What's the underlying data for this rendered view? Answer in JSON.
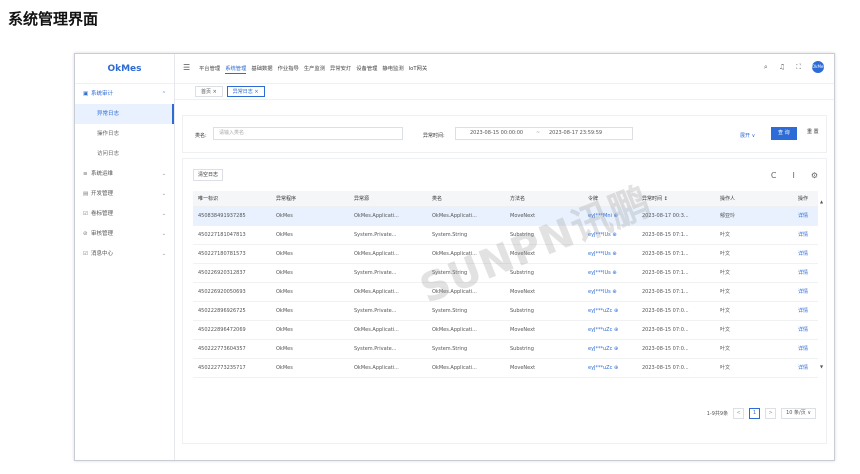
{
  "page_heading": "系统管理界面",
  "sidebar": {
    "logo": "OkMes",
    "groups": [
      {
        "icon": "▣",
        "label": "系统审计",
        "chevron": "⌃",
        "open": true,
        "children": [
          "异常日志",
          "操作日志",
          "访问日志"
        ]
      },
      {
        "icon": "≡",
        "label": "系统运维",
        "chevron": "⌄"
      },
      {
        "icon": "▤",
        "label": "开发管理",
        "chevron": "⌄"
      },
      {
        "icon": "☑",
        "label": "卷标管理",
        "chevron": "⌄"
      },
      {
        "icon": "⊘",
        "label": "审核管理",
        "chevron": "⌄"
      },
      {
        "icon": "☑",
        "label": "消息中心",
        "chevron": "⌄"
      }
    ]
  },
  "topbar": {
    "hamburger": "☰",
    "nav": [
      "平台管理",
      "系统管理",
      "基础数据",
      "作业指导",
      "生产监测",
      "异常安灯",
      "设备管理",
      "静电监测",
      "IoT网关"
    ],
    "icons": [
      "⌕",
      "♫",
      "⛶"
    ],
    "avatar_text": "OkMes"
  },
  "tabs": [
    "首页 ×",
    "异常日志 ×"
  ],
  "search": {
    "class_label": "类名:",
    "class_placeholder": "请输入类名",
    "time_label": "异常时间:",
    "date_start": "2023-08-15 00:00:00",
    "date_sep": "~",
    "date_end": "2023-08-17 23:59:59",
    "expand": "展开 ∨",
    "query": "查 询",
    "reset": "重 置"
  },
  "table": {
    "clear_button": "清空日志",
    "tool_icons": [
      "C",
      "I",
      "⚙"
    ],
    "columns": [
      "唯一标识",
      "异常程序",
      "异常源",
      "类名",
      "方法名",
      "令牌",
      "异常时间 ↕",
      "操作人",
      "操作"
    ],
    "rows": [
      [
        "450838491937285",
        "OkMes",
        "OkMes.Applicati...",
        "OkMes.Applicati...",
        "MoveNext",
        "eyJ***Mni ⊕",
        "2023-08-17 00:3...",
        "郁亚玲",
        "详情"
      ],
      [
        "450227181047813",
        "OkMes",
        "System.Private...",
        "System.String",
        "Substring",
        "eyJ***IUs ⊕",
        "2023-08-15 07:1...",
        "叶文",
        "详情"
      ],
      [
        "450227180781573",
        "OkMes",
        "OkMes.Applicati...",
        "OkMes.Applicati...",
        "MoveNext",
        "eyJ***IUs ⊕",
        "2023-08-15 07:1...",
        "叶文",
        "详情"
      ],
      [
        "450226920312837",
        "OkMes",
        "System.Private...",
        "System.String",
        "Substring",
        "eyJ***IUs ⊕",
        "2023-08-15 07:1...",
        "叶文",
        "详情"
      ],
      [
        "450226920050693",
        "OkMes",
        "OkMes.Applicati...",
        "OkMes.Applicati...",
        "MoveNext",
        "eyJ***IUs ⊕",
        "2023-08-15 07:1...",
        "叶文",
        "详情"
      ],
      [
        "450222896926725",
        "OkMes",
        "System.Private...",
        "System.String",
        "Substring",
        "eyJ***uZc ⊕",
        "2023-08-15 07:0...",
        "叶文",
        "详情"
      ],
      [
        "450222896472069",
        "OkMes",
        "OkMes.Applicati...",
        "OkMes.Applicati...",
        "MoveNext",
        "eyJ***uZc ⊕",
        "2023-08-15 07:0...",
        "叶文",
        "详情"
      ],
      [
        "450222773604357",
        "OkMes",
        "System.Private...",
        "System.String",
        "Substring",
        "eyJ***uZc ⊕",
        "2023-08-15 07:0...",
        "叶文",
        "详情"
      ],
      [
        "450222773235717",
        "OkMes",
        "OkMes.Applicati...",
        "OkMes.Applicati...",
        "MoveNext",
        "eyJ***uZc ⊕",
        "2023-08-15 07:0...",
        "叶文",
        "详情"
      ]
    ]
  },
  "pagination": {
    "total": "1-9共9条",
    "prev": "<",
    "page": "1",
    "next": ">",
    "size": "10 条/页 ∨"
  },
  "watermark": "SUNPN讯鹏",
  "colors": {
    "accent": "#2d6bd6",
    "row_highlight": "#e8f1fd"
  }
}
